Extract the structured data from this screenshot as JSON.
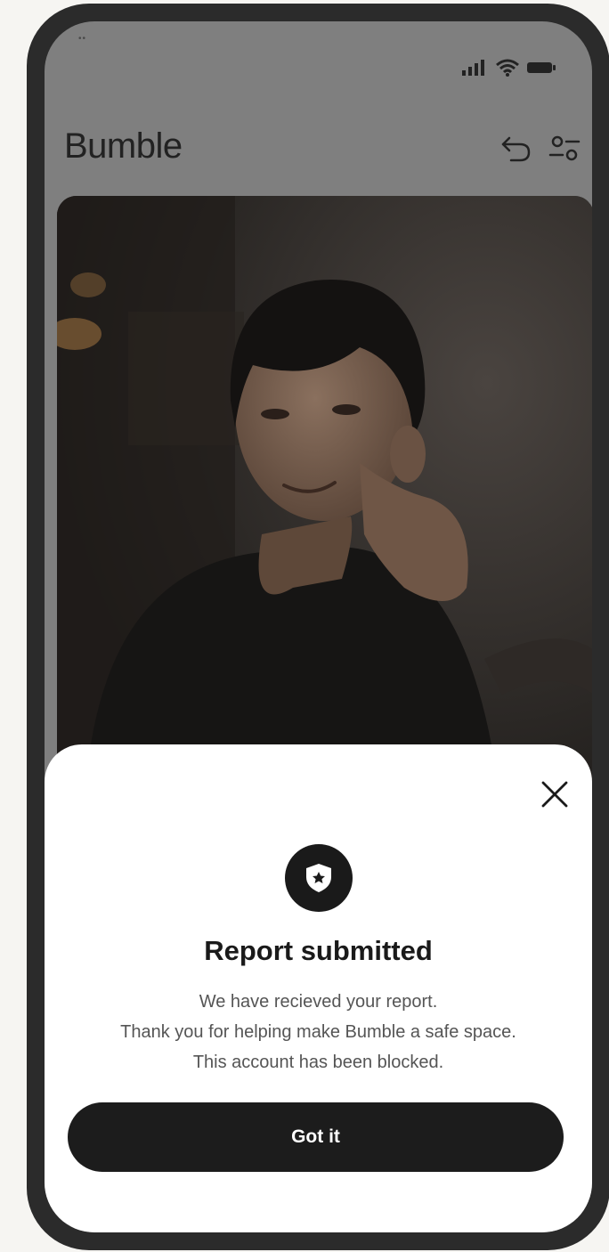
{
  "app": {
    "brand": "Bumble"
  },
  "status_bar": {
    "icons": [
      "signal-icon",
      "wifi-icon",
      "battery-icon"
    ]
  },
  "header": {
    "icons": [
      "undo-icon",
      "filter-icon"
    ]
  },
  "profile": {
    "photo": "profile-photo"
  },
  "sheet": {
    "title": "Report submitted",
    "lines": [
      "We have recieved your report.",
      "Thank you for helping make Bumble a safe space.",
      "This account has been blocked."
    ],
    "button_label": "Got it",
    "icons": [
      "close-icon",
      "shield-star-icon"
    ]
  },
  "colors": {
    "overlay": "#7f7f7f",
    "sheet": "#ffffff",
    "button": "#1c1c1c",
    "frame": "#2b2b2b"
  }
}
